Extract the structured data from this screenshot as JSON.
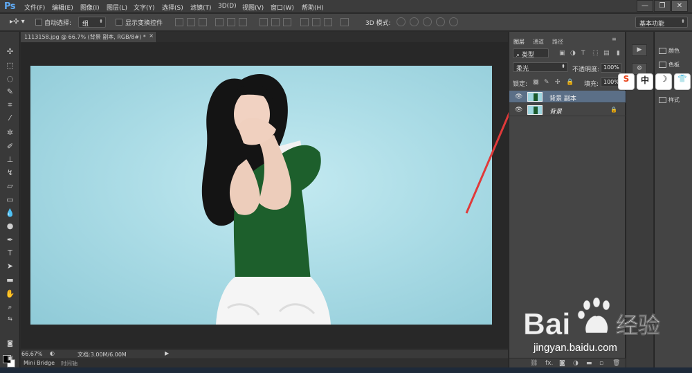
{
  "app": {
    "logo": "Ps"
  },
  "menu": [
    "文件(F)",
    "编辑(E)",
    "图像(I)",
    "图层(L)",
    "文字(Y)",
    "选择(S)",
    "滤镜(T)",
    "3D(D)",
    "视图(V)",
    "窗口(W)",
    "帮助(H)"
  ],
  "window_controls": {
    "minimize": "—",
    "restore": "❐",
    "close": "✕"
  },
  "options": {
    "auto_select_label": "自动选择:",
    "auto_select_value": "组",
    "show_transform_label": "显示变换控件",
    "mode3d_label": "3D 模式:",
    "workspace": "基本功能"
  },
  "document": {
    "tab_title": "1113158.jpg @ 66.7% (背景 副本, RGB/8#) *",
    "tab_close": "×",
    "zoom": "66.67%",
    "doc_info": "文档:3.00M/6.00M"
  },
  "bottom_tabs": [
    "Mini Bridge",
    "时间轴"
  ],
  "layers_panel": {
    "tabs": [
      "图层",
      "通道",
      "路径"
    ],
    "filter_kind": "类型",
    "blend_mode": "柔光",
    "opacity_label": "不透明度:",
    "opacity_value": "100%",
    "lock_label": "锁定:",
    "fill_label": "填充:",
    "fill_value": "100%",
    "layers": [
      {
        "name": "背景 副本",
        "selected": true,
        "locked": false
      },
      {
        "name": "背景",
        "selected": false,
        "locked": true
      }
    ],
    "footer_icons": [
      "link-icon",
      "fx-icon",
      "mask-icon",
      "adjustment-icon",
      "group-icon",
      "new-layer-icon",
      "trash-icon"
    ],
    "fx_label": "fx."
  },
  "right_panels": {
    "items": [
      {
        "label": "颜色",
        "icon": "palette-icon"
      },
      {
        "label": "色板",
        "icon": "swatches-icon"
      },
      {
        "label": "样式",
        "icon": "styles-icon"
      }
    ]
  },
  "ime_toolbar": [
    {
      "label": "S",
      "icon": "sogou-icon",
      "color": "#e8441c"
    },
    {
      "label": "中",
      "icon": "chinese-mode-icon",
      "color": "#222222"
    },
    {
      "label": "☽",
      "icon": "half-width-icon",
      "color": "#222222"
    },
    {
      "label": "👕",
      "icon": "skin-icon",
      "color": "#222222"
    }
  ],
  "watermark": {
    "brand": "Bai 经验",
    "url": "jingyan.baidu.com"
  },
  "colors": {
    "ps_blue": "#5fa8f0",
    "panel_bg": "#454545",
    "selected_layer": "#5b6f87",
    "annotation_arrow": "#e03a3a",
    "backdrop": "#abdce6"
  }
}
